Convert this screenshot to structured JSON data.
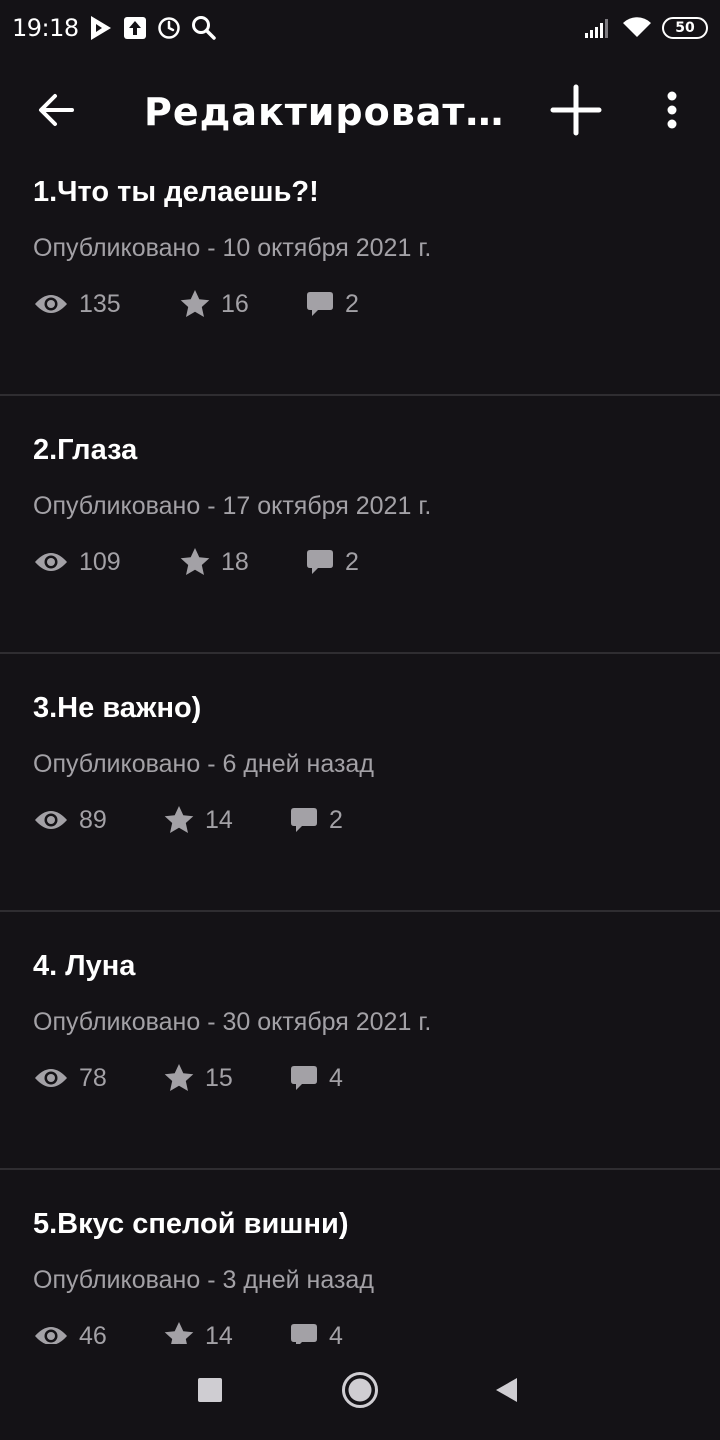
{
  "status_bar": {
    "time": "19:18",
    "battery": "50"
  },
  "app_bar": {
    "title": "Редактировать..."
  },
  "chapters": [
    {
      "title": "1.Что ты делаешь?!",
      "date": "Опубликовано - 10 октября 2021 г.",
      "views": "135",
      "stars": "16",
      "comments": "2"
    },
    {
      "title": "2.Глаза",
      "date": "Опубликовано - 17 октября 2021 г.",
      "views": "109",
      "stars": "18",
      "comments": "2"
    },
    {
      "title": "3.Не важно)",
      "date": "Опубликовано - 6 дней назад",
      "views": "89",
      "stars": "14",
      "comments": "2"
    },
    {
      "title": "4. Луна",
      "date": "Опубликовано - 30 октября 2021 г.",
      "views": "78",
      "stars": "15",
      "comments": "4"
    },
    {
      "title": "5.Вкус спелой вишни)",
      "date": "Опубликовано - 3 дней назад",
      "views": "46",
      "stars": "14",
      "comments": "4"
    }
  ],
  "colors": {
    "background": "#141216",
    "text_primary": "#ffffff",
    "text_secondary": "#a3a1a6",
    "divider": "#2f2d31"
  },
  "icons": {
    "back": "arrow-left-icon",
    "add": "plus-icon",
    "more": "more-vertical-icon",
    "views": "eye-icon",
    "stars": "star-icon",
    "comments": "comment-icon"
  }
}
